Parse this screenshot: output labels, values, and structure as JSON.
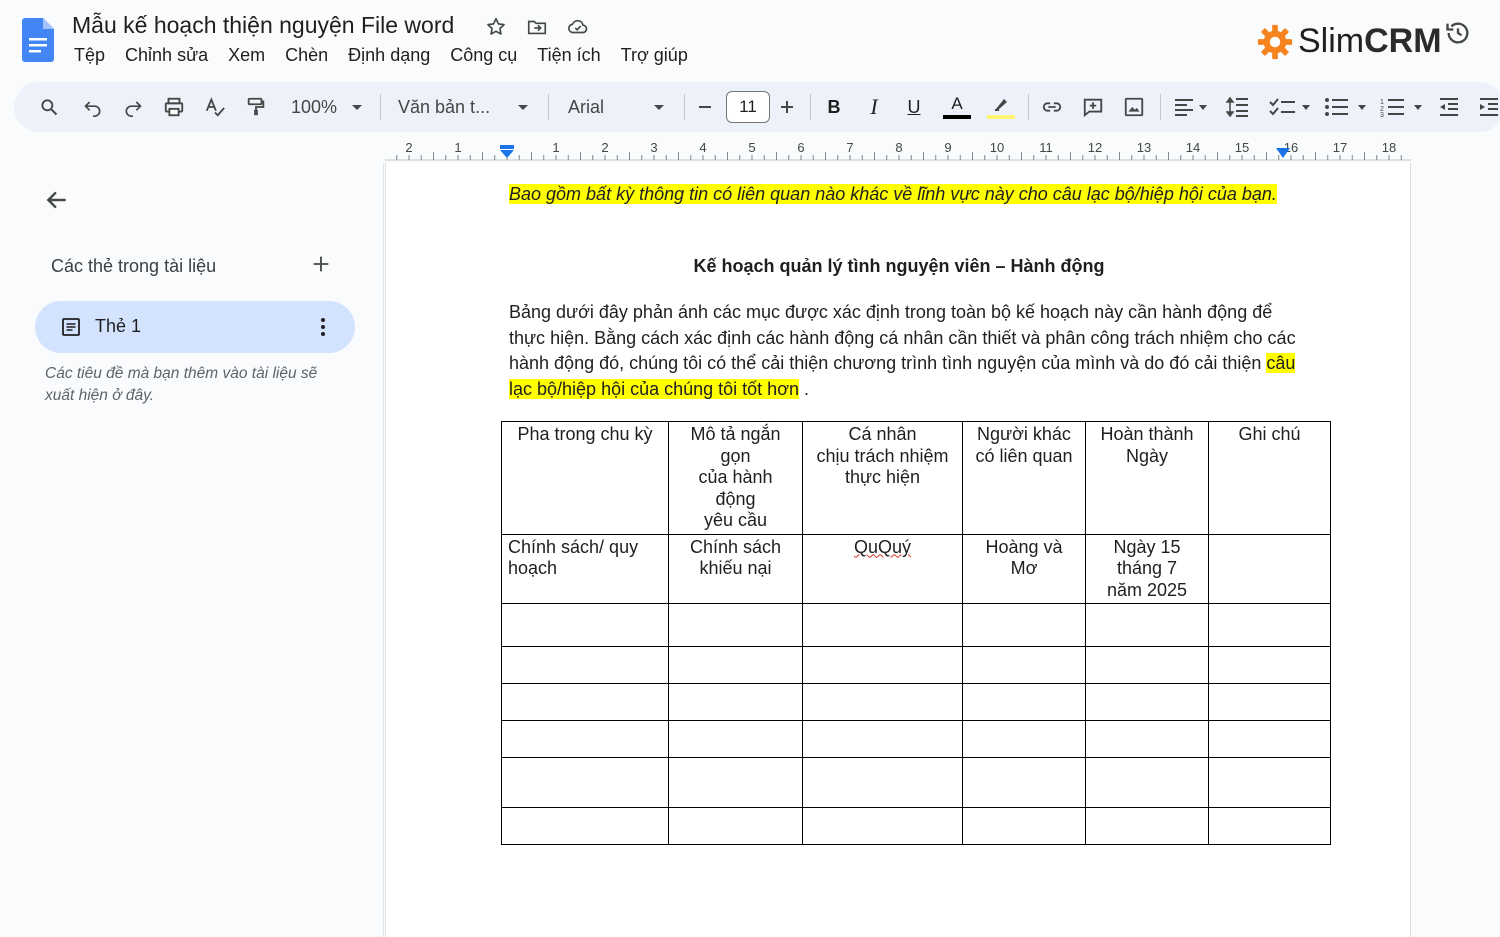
{
  "document": {
    "title": "Mẫu kế hoạch thiện nguyện File word"
  },
  "menu": [
    "Tệp",
    "Chỉnh sửa",
    "Xem",
    "Chèn",
    "Định dạng",
    "Công cụ",
    "Tiện ích",
    "Trợ giúp"
  ],
  "brand": {
    "slim": "Slim",
    "crm": "CRM"
  },
  "toolbar": {
    "zoom": "100%",
    "style": "Văn bản t...",
    "font": "Arial",
    "font_size": "11",
    "bold": "B",
    "italic": "I",
    "underline": "U",
    "text_color_letter": "A",
    "text_color": "#000000",
    "highlight_color": "#fff475"
  },
  "ruler": {
    "labels": [
      "2",
      "1",
      "1",
      "2",
      "3",
      "4",
      "5",
      "6",
      "7",
      "8",
      "9",
      "10",
      "11",
      "12",
      "13",
      "14",
      "15",
      "16",
      "17",
      "18"
    ]
  },
  "outline": {
    "heading": "Các thẻ trong tài liệu",
    "tab_label": "Thẻ 1",
    "hint": "Các tiêu đề mà bạn thêm vào tài liệu sẽ xuất hiện ở đây."
  },
  "content": {
    "intro": "Bao gồm bất kỳ thông tin có liên quan nào khác về lĩnh vực này cho câu lạc bộ/hiệp hội của bạn.",
    "heading": "Kế hoạch quản lý tình nguyện viên – Hành động",
    "body": "Bảng dưới đây phản ánh các mục được xác định trong toàn bộ kế hoạch này cần hành động để thực hiện. Bằng cách xác định các hành động cá nhân cần thiết và phân công trách nhiệm cho các hành động đó, chúng tôi có thể cải thiện chương trình tình nguyện của mình và do đó cải thiện ",
    "body_highlight": "câu lạc bộ/hiệp hội của chúng tôi tốt hơn",
    "body_end": " ."
  },
  "table": {
    "headers": [
      "Pha trong chu kỳ",
      "Mô tả ngắn\ngọn\ncủa hành\nđộng\nyêu cầu",
      "Cá nhân\nchịu trách nhiệm\nthực hiện",
      "Người khác\ncó liên quan",
      "Hoàn thành\nNgày",
      "Ghi chú"
    ],
    "row1": [
      "Chính sách/ quy\nhoạch",
      "Chính sách\nkhiếu nại",
      "QuQuý",
      "Hoàng và\nMơ",
      "Ngày 15\ntháng 7\nnăm 2025",
      ""
    ]
  },
  "icons": [
    "docs-icon",
    "star-icon",
    "folder-move-icon",
    "cloud-icon",
    "gear-logo-icon",
    "history-icon",
    "search-icon",
    "undo-icon",
    "redo-icon",
    "print-icon",
    "spellcheck-icon",
    "paint-format-icon",
    "link-icon",
    "comment-icon",
    "image-icon",
    "align-icon",
    "line-spacing-icon",
    "checklist-icon",
    "bullet-list-icon",
    "numbered-list-icon",
    "indent-decrease-icon",
    "indent-increase-icon"
  ]
}
